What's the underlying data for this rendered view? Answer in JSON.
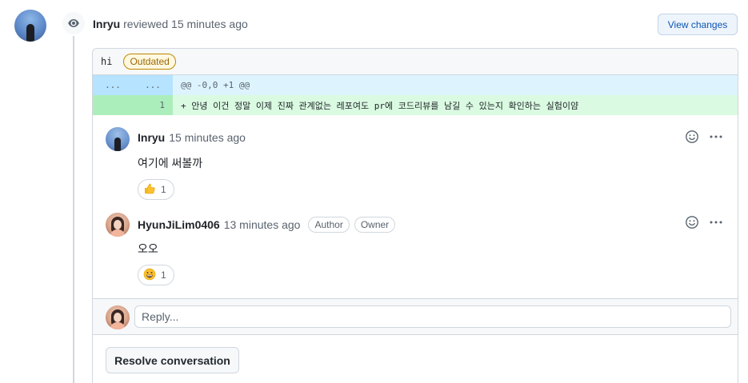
{
  "review": {
    "reviewer": "Inryu",
    "action": "reviewed",
    "time": "15 minutes ago",
    "view_changes_label": "View changes"
  },
  "thread": {
    "file_name": "hi",
    "outdated_label": "Outdated",
    "diff": {
      "hunk_left_num": "...",
      "hunk_right_num": "...",
      "hunk_header": "@@ -0,0 +1 @@",
      "added_line_num": "1",
      "added_line": "+ 안녕 이건 정말 이제 진짜 관계없는 레포여도 pr에 코드리뷰를 남길 수 있는지 확인하는 실험이얌"
    },
    "comments": [
      {
        "author": "Inryu",
        "time": "15 minutes ago",
        "body": "여기에 써볼까",
        "reaction": {
          "emoji": "thumbs-up",
          "count": "1"
        }
      },
      {
        "author": "HyunJiLim0406",
        "time": "13 minutes ago",
        "badges": [
          "Author",
          "Owner"
        ],
        "body": "오오",
        "reaction": {
          "emoji": "grinning-face",
          "count": "1"
        }
      }
    ],
    "reply_placeholder": "Reply...",
    "resolve_label": "Resolve conversation"
  }
}
